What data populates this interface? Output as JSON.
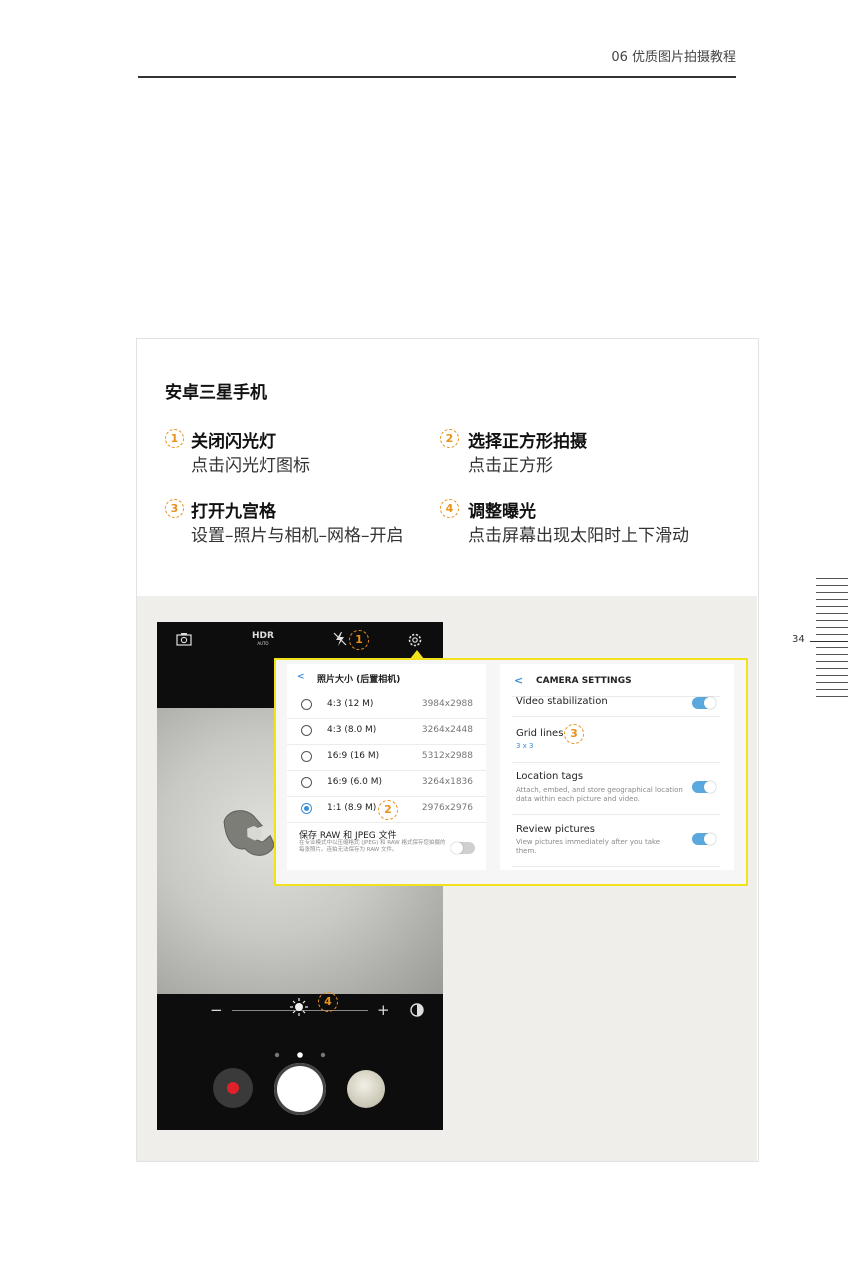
{
  "header": {
    "chapter": "06 优质图片拍摄教程"
  },
  "page_number": "34",
  "card": {
    "title": "安卓三星手机",
    "steps": [
      {
        "num": "1",
        "title": "关闭闪光灯",
        "desc": "点击闪光灯图标"
      },
      {
        "num": "2",
        "title": "选择正方形拍摄",
        "desc": "点击正方形"
      },
      {
        "num": "3",
        "title": "打开九宫格",
        "desc": "设置–照片与相机–网格–开启"
      },
      {
        "num": "4",
        "title": "调整曝光",
        "desc": "点击屏幕出现太阳时上下滑动"
      }
    ]
  },
  "camera": {
    "hdr_label": "HDR",
    "hdr_sub": "AUTO",
    "switch_icon": "camera-switch-icon",
    "flash_icon": "flash-off-icon",
    "settings_icon": "gear-icon",
    "exposure_minus": "−",
    "exposure_plus": "+",
    "markers": [
      "1",
      "2",
      "3",
      "4"
    ],
    "exposure_level": 0.5,
    "active_dot": 2
  },
  "photo_size_panel": {
    "back": "<",
    "title": "照片大小 (后置相机)",
    "options": [
      {
        "label": "4:3 (12 M)",
        "res": "3984x2988",
        "selected": false
      },
      {
        "label": "4:3 (8.0 M)",
        "res": "3264x2448",
        "selected": false
      },
      {
        "label": "16:9 (16 M)",
        "res": "5312x2988",
        "selected": false
      },
      {
        "label": "16:9 (6.0 M)",
        "res": "3264x1836",
        "selected": false
      },
      {
        "label": "1:1 (8.9 M)",
        "res": "2976x2976",
        "selected": true
      }
    ],
    "raw_title": "保存 RAW 和 JPEG 文件",
    "raw_desc": "在专业模式中以压缩格式 (JPEG) 和 RAW 格式保存您拍摄的每张照片。连拍无法保存为 RAW 文件。",
    "raw_enabled": false
  },
  "camera_settings_panel": {
    "back": "<",
    "title": "CAMERA SETTINGS",
    "items": [
      {
        "label": "Video stabilization",
        "enabled": true
      },
      {
        "label": "Grid lines",
        "value": "3 x 3"
      },
      {
        "label": "Location tags",
        "desc": "Attach, embed, and store geographical location data within each picture and video.",
        "enabled": true
      },
      {
        "label": "Review pictures",
        "desc": "View pictures immediately after you take them.",
        "enabled": true
      }
    ]
  },
  "colors": {
    "accent": "#e8911b",
    "highlight": "#f2e21c",
    "toggle_on": "#5aa9de",
    "record": "#e0202a"
  }
}
